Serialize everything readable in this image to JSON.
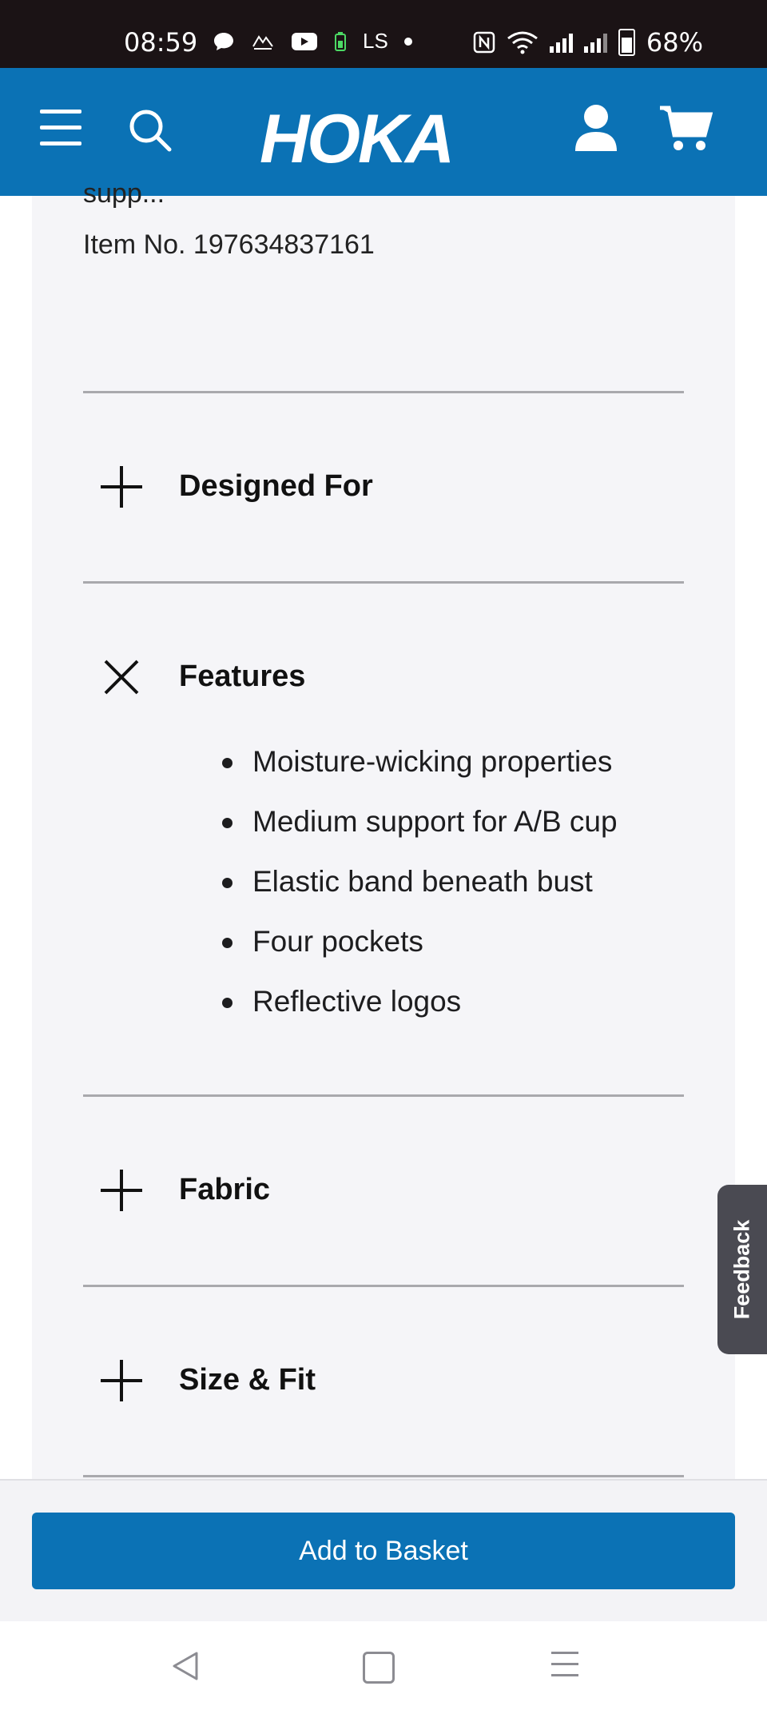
{
  "status_bar": {
    "time": "08:59",
    "battery": "68%",
    "left_icons": [
      "chat-bubble-icon",
      "avarn-app-icon",
      "youtube-icon",
      "battery-saver-icon",
      "ls-app-icon",
      "dot-icon"
    ],
    "ls_label": "LS",
    "right_icons": [
      "nfc-icon",
      "wifi-icon",
      "signal-icon",
      "signal-icon",
      "battery-icon"
    ]
  },
  "header": {
    "logo": "HOKA",
    "icons": [
      "menu-icon",
      "search-icon",
      "account-icon",
      "cart-icon"
    ],
    "background": "#0b72b5"
  },
  "product": {
    "cut_off_text": "supp...",
    "item_number": "Item No. 197634837161"
  },
  "accordion": {
    "designed_for": {
      "title": "Designed For",
      "state": "collapsed"
    },
    "features": {
      "title": "Features",
      "state": "expanded",
      "items": [
        "Moisture-wicking properties",
        "Medium support for A/B cup",
        "Elastic band beneath bust",
        "Four pockets",
        "Reflective logos"
      ]
    },
    "fabric": {
      "title": "Fabric",
      "state": "collapsed"
    },
    "size_fit": {
      "title": "Size & Fit",
      "state": "collapsed"
    }
  },
  "feedback_tab": {
    "label": "Feedback"
  },
  "footer": {
    "add_to_basket": "Add to Basket",
    "accent": "#0b72b5"
  },
  "android_nav": {
    "icons": [
      "back-icon",
      "home-icon",
      "recents-icon"
    ]
  }
}
